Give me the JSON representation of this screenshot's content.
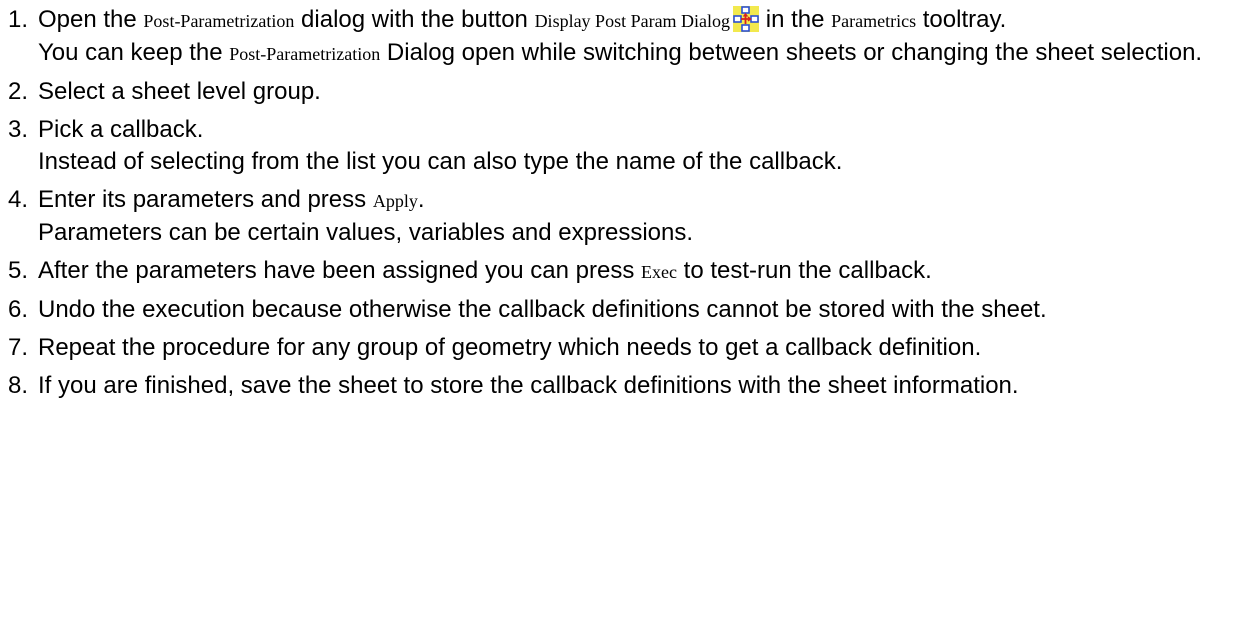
{
  "steps": [
    {
      "number": "1.",
      "line": [
        {
          "t": "Open the "
        },
        {
          "t": "Post-Parametrization",
          "ui": true
        },
        {
          "t": " dialog with the button "
        },
        {
          "t": "Display Post Param Dialog",
          "ui": true
        },
        {
          "icon": "post-param-dialog-icon"
        },
        {
          "t": " in the "
        },
        {
          "t": "Parametrics",
          "ui": true
        },
        {
          "t": " tooltray."
        }
      ],
      "note": [
        {
          "t": "You can keep the "
        },
        {
          "t": "Post-Parametrization",
          "ui": true
        },
        {
          "t": " Dialog open while switching between sheets or changing the sheet selection."
        }
      ]
    },
    {
      "number": "2.",
      "line": [
        {
          "t": "Select a sheet level group."
        }
      ]
    },
    {
      "number": "3.",
      "line": [
        {
          "t": "Pick a callback."
        }
      ],
      "note": [
        {
          "t": "Instead of selecting from the list you can also type the name of the callback."
        }
      ]
    },
    {
      "number": "4.",
      "line": [
        {
          "t": "Enter its parameters and press "
        },
        {
          "t": "Apply",
          "ui": true
        },
        {
          "t": "."
        }
      ],
      "note": [
        {
          "t": "Parameters can be certain values, variables and expressions."
        }
      ]
    },
    {
      "number": "5.",
      "line": [
        {
          "t": "After the parameters have been assigned you can press "
        },
        {
          "t": "Exec",
          "ui": true
        },
        {
          "t": " to test-run the callback."
        }
      ]
    },
    {
      "number": "6.",
      "line": [
        {
          "t": "Undo the execution because otherwise the callback definitions cannot be stored with the sheet."
        }
      ]
    },
    {
      "number": "7.",
      "line": [
        {
          "t": "Repeat the procedure for any group of geometry which needs to get a callback definition."
        }
      ]
    },
    {
      "number": "8.",
      "line": [
        {
          "t": "If you are finished, save the sheet to store the callback definitions with the sheet information."
        }
      ]
    }
  ],
  "colors": {
    "icon_bg": "#f2e94e",
    "icon_box": "#2b4fd6",
    "icon_arrow": "#d62020"
  }
}
